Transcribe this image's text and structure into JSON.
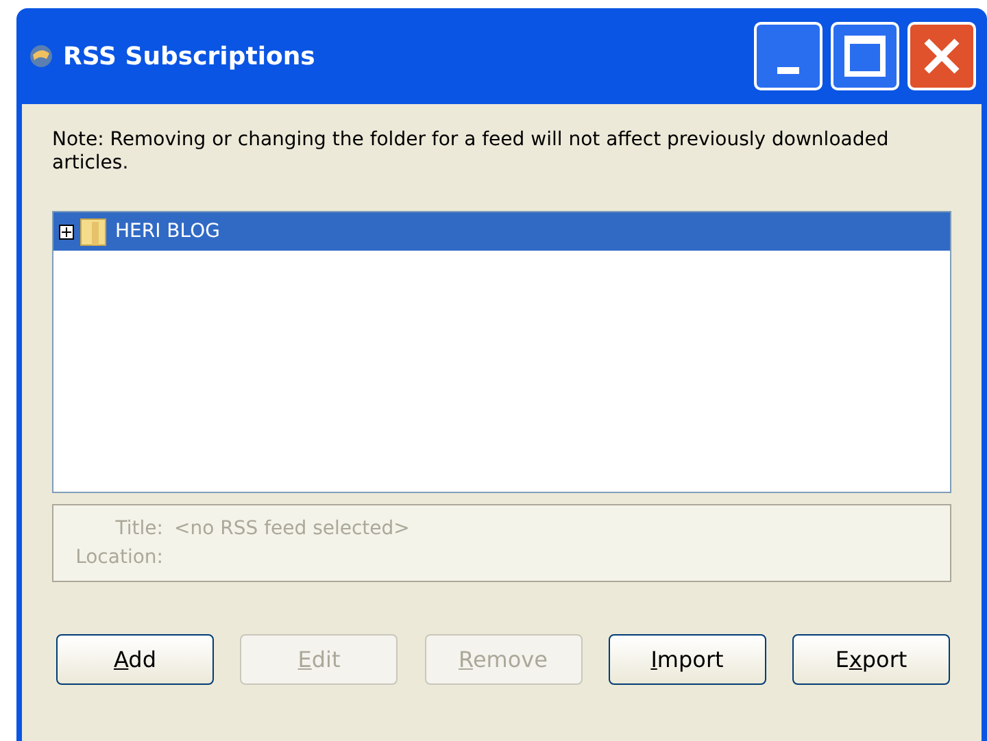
{
  "window": {
    "title": "RSS Subscriptions"
  },
  "note": "Note: Removing or changing the folder for a feed will not affect previously downloaded articles.",
  "tree": {
    "items": [
      {
        "label": "HERI BLOG",
        "expanded": false,
        "selected": true
      }
    ]
  },
  "details": {
    "title_label": "Title:",
    "title_value": "<no RSS feed selected>",
    "location_label": "Location:",
    "disabled": true
  },
  "buttons": [
    {
      "key": "A",
      "rest": "dd",
      "disabled": false
    },
    {
      "key": "E",
      "rest": "dit",
      "disabled": true
    },
    {
      "key": "R",
      "rest": "emove",
      "disabled": true
    },
    {
      "key": "I",
      "rest": "mport",
      "disabled": false
    },
    {
      "lead": "E",
      "key": "x",
      "rest": "port",
      "disabled": false
    }
  ]
}
